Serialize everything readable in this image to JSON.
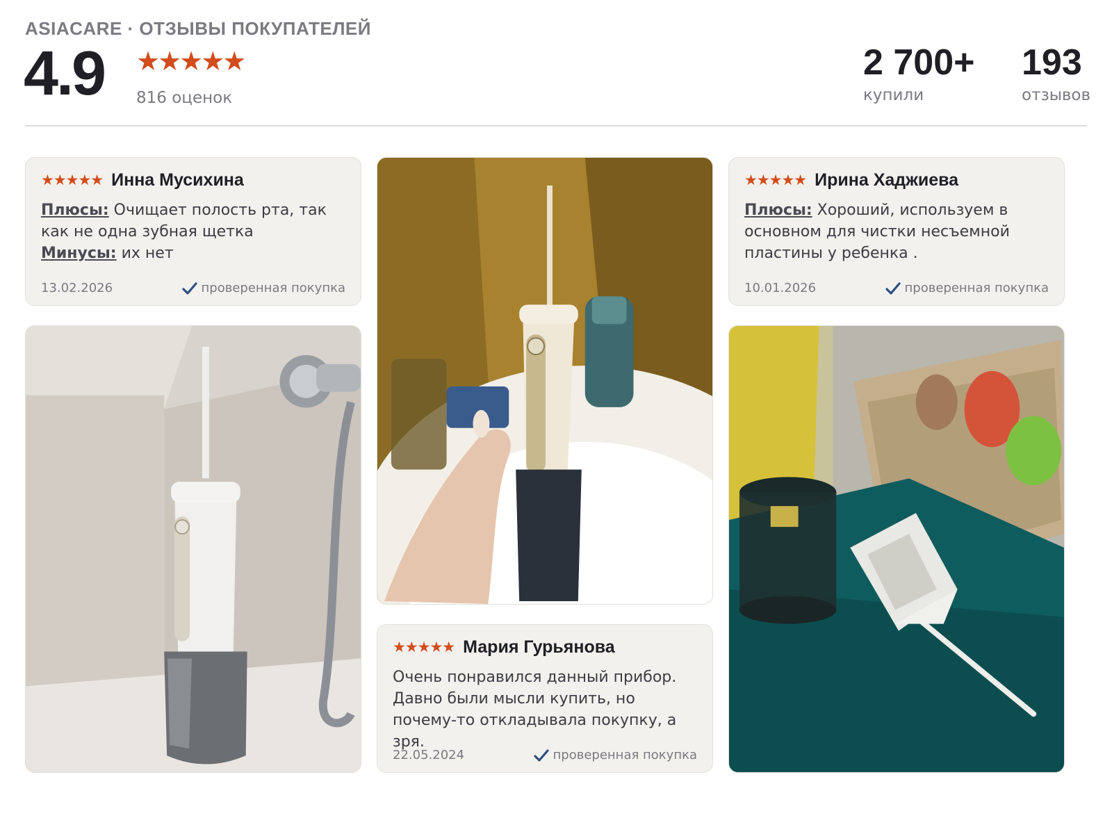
{
  "header": {
    "brand": "ASIACARE · ОТЗЫВЫ ПОКУПАТЕЛЕЙ",
    "rating": "4.9",
    "stars": "★★★★★",
    "ratings_count": "816 оценок",
    "bought_value": "2 700+",
    "bought_label": "купили",
    "reviews_value": "193",
    "reviews_label": "отзывов"
  },
  "reviews": [
    {
      "stars": "★★★★★",
      "name": "Инна Мусихина",
      "pros_label": "Плюсы:",
      "pros_text": " Очищает полость рта, так как не одна зубная щетка",
      "cons_label": "Минусы:",
      "cons_text": " их нет",
      "date": "13.02.2026",
      "verified": "проверенная покупка"
    },
    {
      "stars": "★★★★★",
      "name": "Ирина Хаджиева",
      "pros_label": "Плюсы:",
      "pros_text": " Хороший, используем в основном для чистки несъемной пластины у ребенка .",
      "date": "10.01.2026",
      "verified": "проверенная покупка"
    },
    {
      "stars": "★★★★★",
      "name": "Мария Гурьянова",
      "text": "Очень понравился данный прибор. Давно были мысли купить, но почему-то откладывала покупку, а зря.",
      "date": "22.05.2024",
      "verified": "проверенная покупка"
    }
  ],
  "colors": {
    "star": "#d24c1c",
    "card_bg": "#f2f1ee",
    "check": "#2d4f7c"
  },
  "icons": {
    "check": "check-icon",
    "star": "star-icon"
  }
}
